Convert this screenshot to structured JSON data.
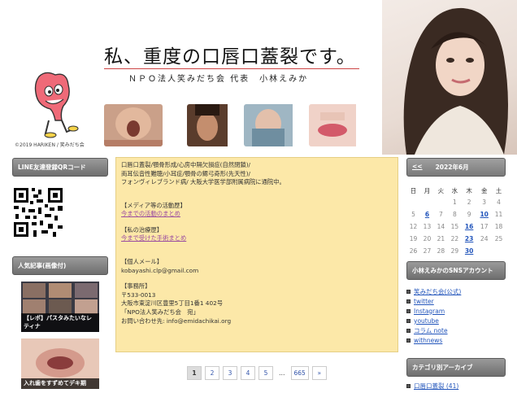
{
  "header": {
    "title": "私、重度の口唇口蓋裂です。",
    "subtitle": "ＮＰＯ法人笑みだち会 代表　小林えみか",
    "copyright": "©2019 HARIKEN / 笑みだち会"
  },
  "left_sidebar": {
    "qr_title": "LINE友達登録QRコード",
    "popular_title": "人気記事(画像付)",
    "popular_items": [
      {
        "caption": "【レポ】パスタみたいなレティナ"
      },
      {
        "caption": "入れ歯をすずめてデキ期"
      }
    ]
  },
  "main": {
    "lines": [
      "口唇口蓋裂/顎骨形成/心房中隔欠損症(自然閉鎖)/",
      "両耳伝音性難聴/小耳症/顎骨の鰓弓奇形(先天性)/",
      "フォンヴィレブランド病/ 大阪大学医学部附属病院に通院中。"
    ],
    "media_heading": "【メディア等の活動歴】",
    "media_link": "今までの活動のまとめ",
    "treatment_heading": "【私の治療歴】",
    "treatment_link": "今まで受けた手術まとめ",
    "mail_heading": "【個人メール】",
    "mail": "kobayashi.clp@gmail.com",
    "office_heading": "【事務所】",
    "office_lines": [
      "〒533-0013",
      "大阪市東淀川区豊里5丁目1番1 402号",
      "「NPO法人笑みだち会　宛」",
      "お問い合わせ先: info@emidachikai.org"
    ]
  },
  "pagination": [
    "1",
    "2",
    "3",
    "4",
    "5",
    "…",
    "665",
    "»"
  ],
  "calendar": {
    "prev": "<<",
    "month": "2022年6月",
    "weekdays": [
      "日",
      "月",
      "火",
      "水",
      "木",
      "金",
      "土"
    ],
    "weeks": [
      [
        "",
        "",
        "",
        "1",
        "2",
        "3",
        "4"
      ],
      [
        "5",
        "6",
        "7",
        "8",
        "9",
        "10",
        "11"
      ],
      [
        "12",
        "13",
        "14",
        "15",
        "16",
        "17",
        "18"
      ],
      [
        "19",
        "20",
        "21",
        "22",
        "23",
        "24",
        "25"
      ],
      [
        "26",
        "27",
        "28",
        "29",
        "30",
        "",
        ""
      ]
    ],
    "linked_days": [
      "6",
      "10",
      "16",
      "23",
      "30"
    ]
  },
  "right_sidebar": {
    "sns_title": "小林えみかのSNSアカウント",
    "sns_links": [
      "笑みだち会(公式)",
      "twitter",
      "Instagram",
      "youtube",
      "コラム note",
      "withnews"
    ],
    "category_title": "カテゴリ別アーカイブ",
    "categories": [
      "口唇口蓋裂 (41)"
    ]
  }
}
